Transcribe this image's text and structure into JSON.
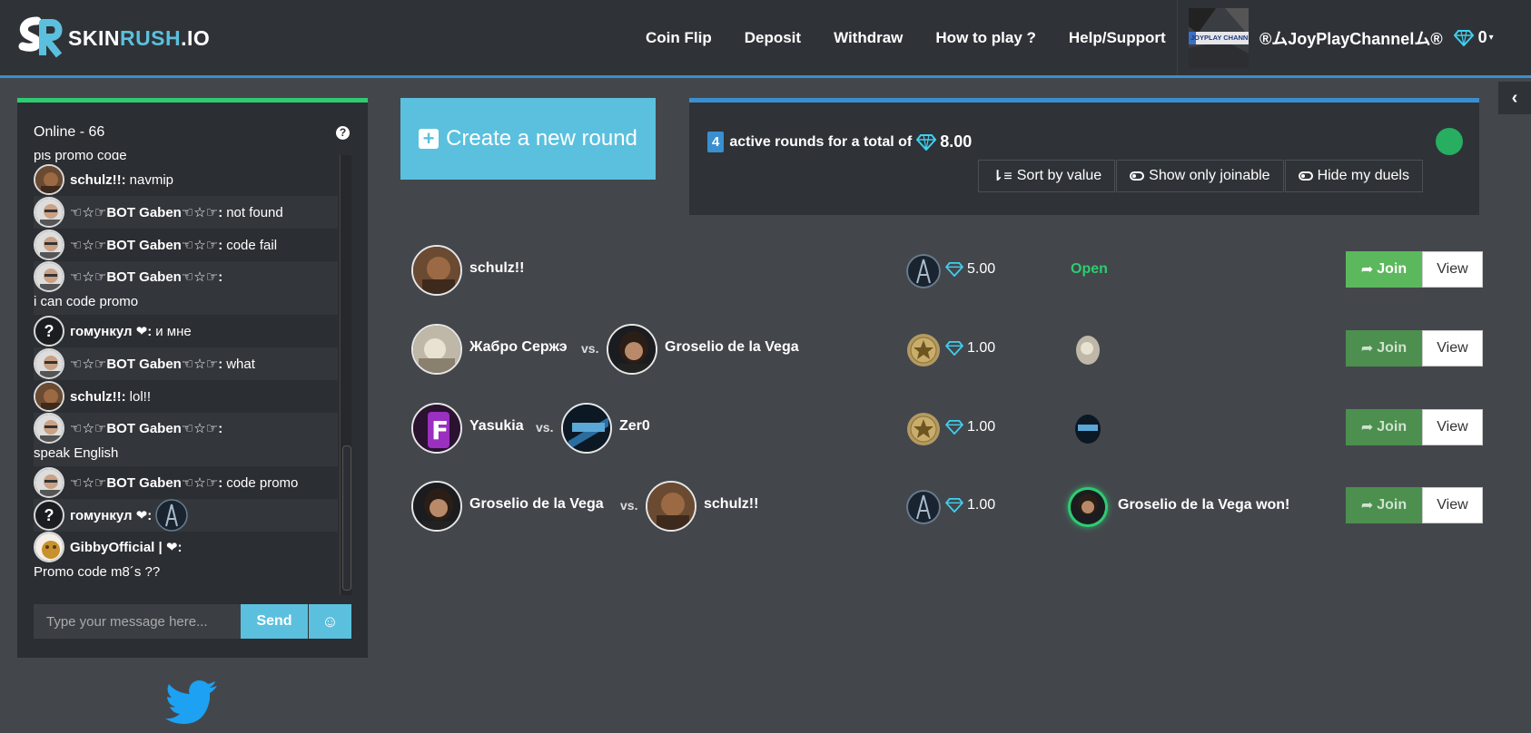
{
  "header": {
    "logo_part1": "SKIN",
    "logo_part2": "RUSH",
    "logo_part3": ".IO",
    "nav": [
      "Coin Flip",
      "Deposit",
      "Withdraw",
      "How to play ?",
      "Help/Support"
    ],
    "avatar_text": "JOYPLAY CHANNEL",
    "username": "®ムJoyPlayChannelム®",
    "balance": "0"
  },
  "chat": {
    "online_label": "Online - 66",
    "help_glyph": "?",
    "messages": [
      {
        "type": "cut",
        "text": "pls promo code"
      },
      {
        "name": "schulz!!:",
        "text": "navmip",
        "avatar": "brown"
      },
      {
        "name": "☜☆☞BOT Gaben☜☆☞:",
        "text": "not found",
        "avatar": "gaben"
      },
      {
        "name": "☜☆☞BOT Gaben☜☆☞:",
        "text": "code fail",
        "avatar": "gaben"
      },
      {
        "name": "☜☆☞BOT Gaben☜☆☞:",
        "text": "",
        "line2": "i can code promo",
        "avatar": "gaben"
      },
      {
        "name": "гомункул ❤:",
        "text": "и мне",
        "avatar": "question"
      },
      {
        "name": "☜☆☞BOT Gaben☜☆☞:",
        "text": "what",
        "avatar": "gaben"
      },
      {
        "name": "schulz!!:",
        "text": "lol!!",
        "avatar": "brown"
      },
      {
        "name": "☜☆☞BOT Gaben☜☆☞:",
        "text": "",
        "line2": "speak English",
        "avatar": "gaben"
      },
      {
        "name": "☜☆☞BOT Gaben☜☆☞:",
        "text": "code promo",
        "avatar": "gaben"
      },
      {
        "name": "гомункул ❤:",
        "text": "",
        "avatar": "question",
        "emblem": true
      },
      {
        "name": "GibbyOfficial | ❤:",
        "text": "",
        "line2": "Promo code m8´s ??",
        "avatar": "gold"
      }
    ],
    "input_placeholder": "Type your message here...",
    "send_label": "Send",
    "emoji_glyph": "☺"
  },
  "main": {
    "create_label": "Create a new round",
    "active_count": "4",
    "active_text": "active rounds for a total of",
    "total_value": "8.00",
    "sort_label": "Sort by value",
    "joinable_label": "Show only joinable",
    "hide_label": "Hide my duels",
    "vs_label": "vs.",
    "join_label": "Join",
    "view_label": "View",
    "rounds": [
      {
        "p1": "schulz!!",
        "p2": "",
        "value": "5.00",
        "status": "Open",
        "rank": "ct"
      },
      {
        "p1": "Жабро Сержэ",
        "p2": "Groselio de la Vega",
        "value": "1.00",
        "status": "",
        "rank": "gold"
      },
      {
        "p1": "Yasukia",
        "p2": "Zer0",
        "value": "1.00",
        "status": "",
        "rank": "gold"
      },
      {
        "p1": "Groselio de la Vega",
        "p2": "schulz!!",
        "value": "1.00",
        "status": "Groselio de la Vega won!",
        "rank": "ct"
      }
    ]
  }
}
